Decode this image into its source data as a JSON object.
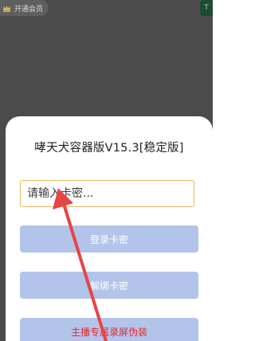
{
  "top_bar": {
    "vip_label": "开通会员",
    "vip_icon": "crown-icon",
    "corner_icon": "exit-icon",
    "corner_label": "T"
  },
  "dialog": {
    "title": "哮天犬容器版V15.3[稳定版]",
    "input": {
      "placeholder": "请输入卡密...",
      "value": ""
    },
    "buttons": {
      "login": "登录卡密",
      "unbind": "解绑卡密",
      "disguise": "主播专属录屏伪装"
    }
  },
  "colors": {
    "overlay": "#4b4b4b",
    "input_border": "#e7b85a",
    "button_fill": "#b3c4ea",
    "disguise_text": "#e02a2a",
    "annotation_arrow": "#e64545"
  }
}
